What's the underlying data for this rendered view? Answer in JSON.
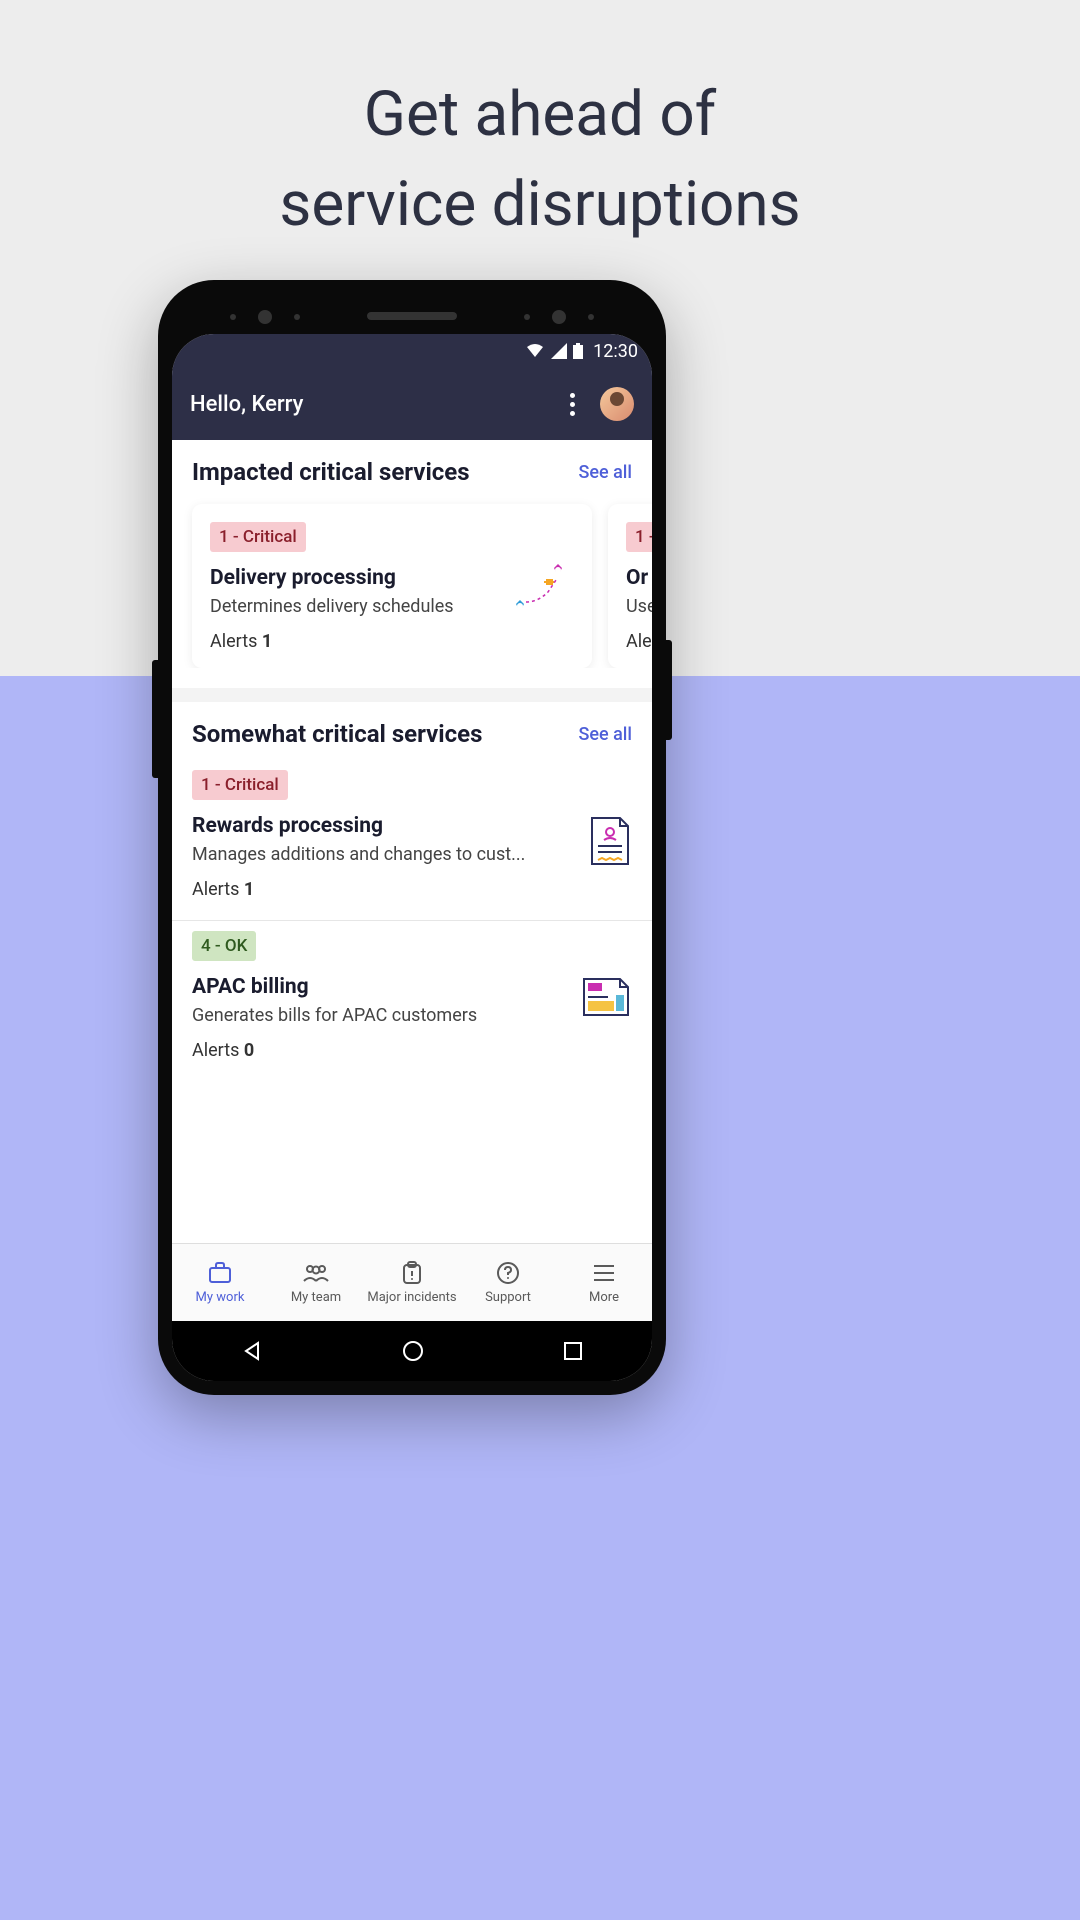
{
  "hero": {
    "title": "Get ahead of\nservice disruptions"
  },
  "status": {
    "time": "12:30"
  },
  "header": {
    "greeting": "Hello, Kerry"
  },
  "sections": {
    "impacted": {
      "title": "Impacted critical services",
      "see_all": "See all",
      "cards": [
        {
          "badge": "1 - Critical",
          "badge_class": "critical",
          "title": "Delivery processing",
          "desc": "Determines delivery schedules",
          "alerts_label": "Alerts",
          "alerts_count": "1"
        },
        {
          "badge": "1 -",
          "badge_class": "critical",
          "title": "Or",
          "desc": "Use",
          "alerts_label": "Ale",
          "alerts_count": ""
        }
      ]
    },
    "somewhat": {
      "title": "Somewhat critical services",
      "see_all": "See all",
      "items": [
        {
          "badge": "1 - Critical",
          "badge_class": "critical",
          "title": "Rewards processing",
          "desc": "Manages additions and changes to cust...",
          "alerts_label": "Alerts",
          "alerts_count": "1"
        },
        {
          "badge": "4 - OK",
          "badge_class": "ok",
          "title": "APAC billing",
          "desc": "Generates bills for APAC customers",
          "alerts_label": "Alerts",
          "alerts_count": "0"
        }
      ]
    }
  },
  "nav": {
    "items": [
      {
        "label": "My work",
        "active": true
      },
      {
        "label": "My team",
        "active": false
      },
      {
        "label": "Major incidents",
        "active": false
      },
      {
        "label": "Support",
        "active": false
      },
      {
        "label": "More",
        "active": false
      }
    ]
  }
}
